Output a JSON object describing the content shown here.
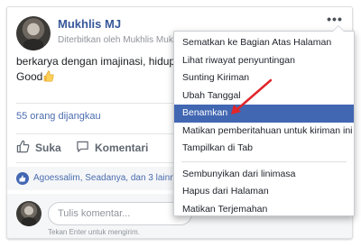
{
  "post": {
    "author": "Mukhlis MJ",
    "meta": "Diterbitkan oleh Mukhlis Mukhlis",
    "text_line1": "berkarya dengan imajinasi, hidupk",
    "text_line2": "Good",
    "reach": "55 orang dijangkau"
  },
  "actions": {
    "like_label": "Suka",
    "comment_label": "Komentari"
  },
  "activity": {
    "text": "Agoessalim, Seadanya, dan 3 lainnya"
  },
  "comment": {
    "placeholder": "Tulis komentar...",
    "hint": "Tekan Enter untuk mengirim."
  },
  "menu": {
    "group1": [
      "Sematkan ke Bagian Atas Halaman",
      "Lihat riwayat penyuntingan",
      "Sunting Kiriman",
      "Ubah Tanggal",
      "Benamkan",
      "Matikan pemberitahuan untuk kiriman ini",
      "Tampilkan di Tab"
    ],
    "group2": [
      "Sembunyikan dari linimasa",
      "Hapus dari Halaman",
      "Matikan Terjemahan"
    ],
    "highlighted_item": "Benamkan"
  },
  "colors": {
    "link_blue": "#365899",
    "menu_highlight": "#4267b2",
    "annotation_arrow": "#e0262b"
  },
  "icons": {
    "more": "more-dots-icon",
    "globe": "globe-icon",
    "like": "thumbs-up-icon",
    "comment": "comment-bubble-icon",
    "like_badge": "like-badge-icon",
    "emoji": "thumbs-up-emoji-icon"
  }
}
